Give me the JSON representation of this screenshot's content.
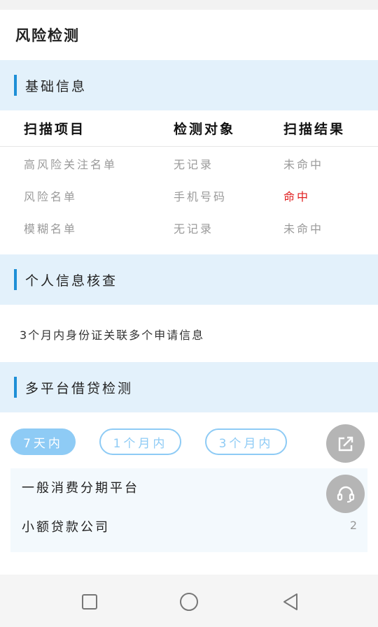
{
  "header": {
    "title": "风险检测"
  },
  "sections": {
    "basic": "基础信息",
    "personal": "个人信息核查",
    "multi": "多平台借贷检测"
  },
  "scan_table": {
    "headers": [
      "扫描项目",
      "检测对象",
      "扫描结果"
    ],
    "rows": [
      {
        "item": "高风险关注名单",
        "target": "无记录",
        "result": "未命中"
      },
      {
        "item": "风险名单",
        "target": "手机号码",
        "result": "命中"
      },
      {
        "item": "模糊名单",
        "target": "无记录",
        "result": "未命中"
      }
    ]
  },
  "personal_info": {
    "text": "3个月内身份证关联多个申请信息"
  },
  "period_tabs": [
    "7天内",
    "1个月内",
    "3个月内"
  ],
  "platforms": [
    {
      "name": "一般消费分期平台",
      "count": ""
    },
    {
      "name": "小额贷款公司",
      "count": "2"
    }
  ],
  "colors": {
    "accent": "#1e8fd6",
    "section_bg": "#e3f1fb",
    "hit": "#e02020",
    "pill": "#8ecbf5"
  }
}
